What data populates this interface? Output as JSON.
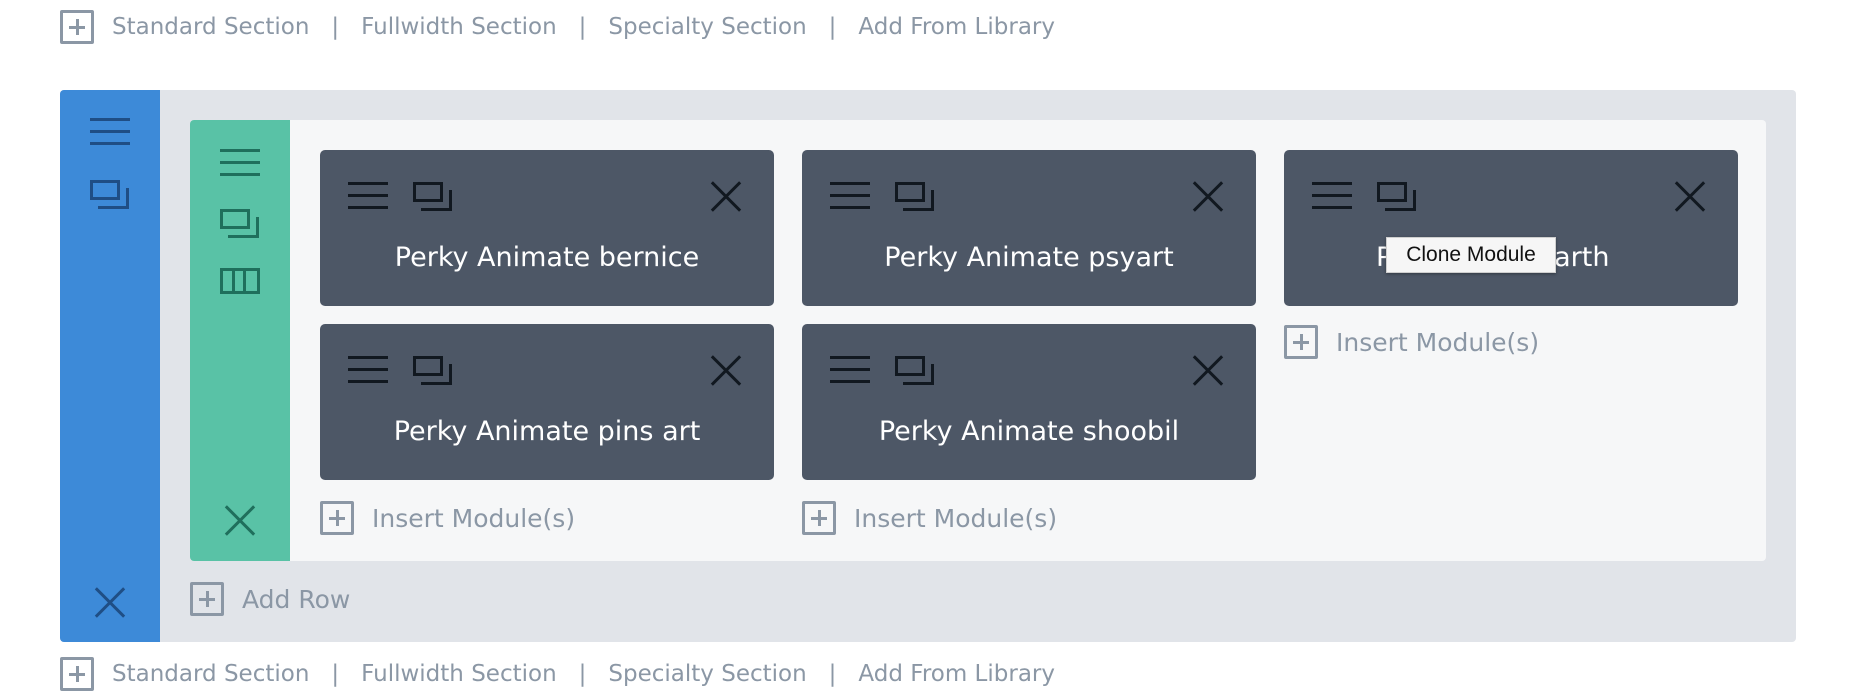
{
  "section_bar": {
    "links": [
      "Standard Section",
      "Fullwidth Section",
      "Specialty Section",
      "Add From Library"
    ],
    "separator": "|"
  },
  "modules": [
    {
      "title": "Perky Animate bernice"
    },
    {
      "title": "Perky Animate psyart"
    },
    {
      "title": "Perky Animate earth",
      "visible_title": "P",
      "visible_title_tail": "e earth"
    },
    {
      "title": "Perky Animate pins art"
    },
    {
      "title": "Perky Animate shoobil"
    }
  ],
  "insert_label": "Insert Module(s)",
  "add_row_label": "Add Row",
  "tooltip": "Clone Module",
  "colors": {
    "section_sidebar": "#3d8ad8",
    "row_sidebar": "#59c2a6",
    "module_bg": "#4d5766",
    "section_bg": "#e1e4e9",
    "muted_text": "#8b97a5"
  },
  "icons": [
    "plus-icon",
    "menu-icon",
    "clone-icon",
    "close-icon",
    "columns-icon"
  ]
}
